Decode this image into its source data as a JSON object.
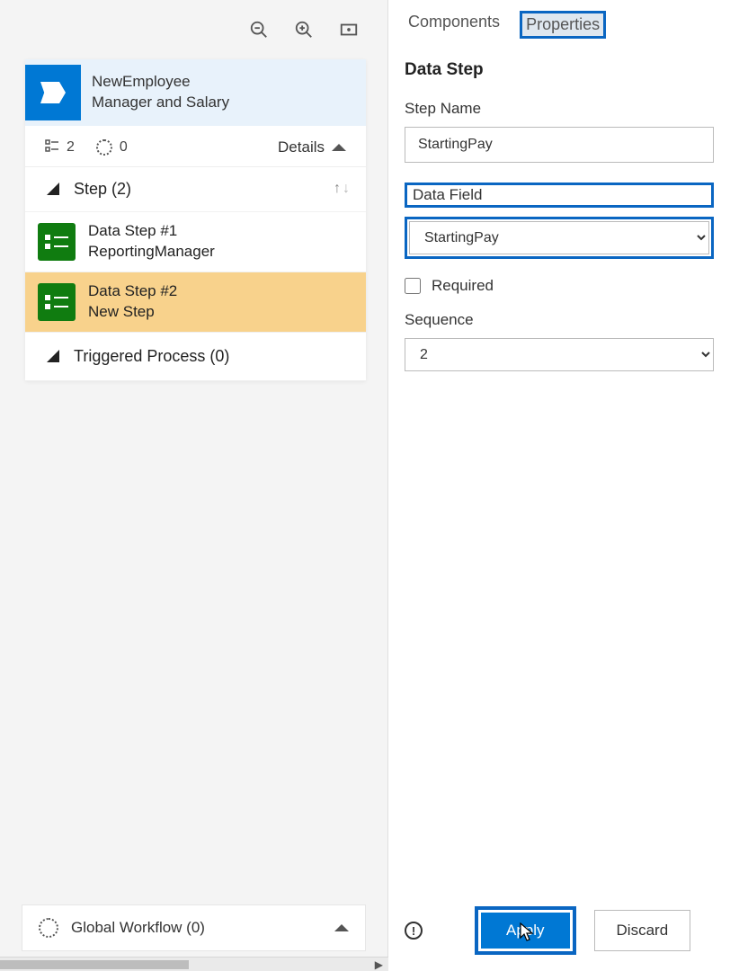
{
  "card": {
    "title_line1": "NewEmployee",
    "title_line2": "Manager and Salary",
    "checklist_count": "2",
    "progress_count": "0",
    "details_label": "Details"
  },
  "steps": {
    "section_label": "Step (2)",
    "items": [
      {
        "title": "Data Step #1",
        "sub": "ReportingManager"
      },
      {
        "title": "Data Step #2",
        "sub": "New Step"
      }
    ],
    "triggered_label": "Triggered Process (0)"
  },
  "global_workflow": {
    "label": "Global Workflow (0)"
  },
  "tabs": {
    "components": "Components",
    "properties": "Properties"
  },
  "form": {
    "heading": "Data Step",
    "step_name_label": "Step Name",
    "step_name_value": "StartingPay",
    "data_field_label": "Data Field",
    "data_field_value": "StartingPay",
    "required_label": "Required",
    "sequence_label": "Sequence",
    "sequence_value": "2"
  },
  "footer": {
    "apply": "Apply",
    "discard": "Discard"
  }
}
